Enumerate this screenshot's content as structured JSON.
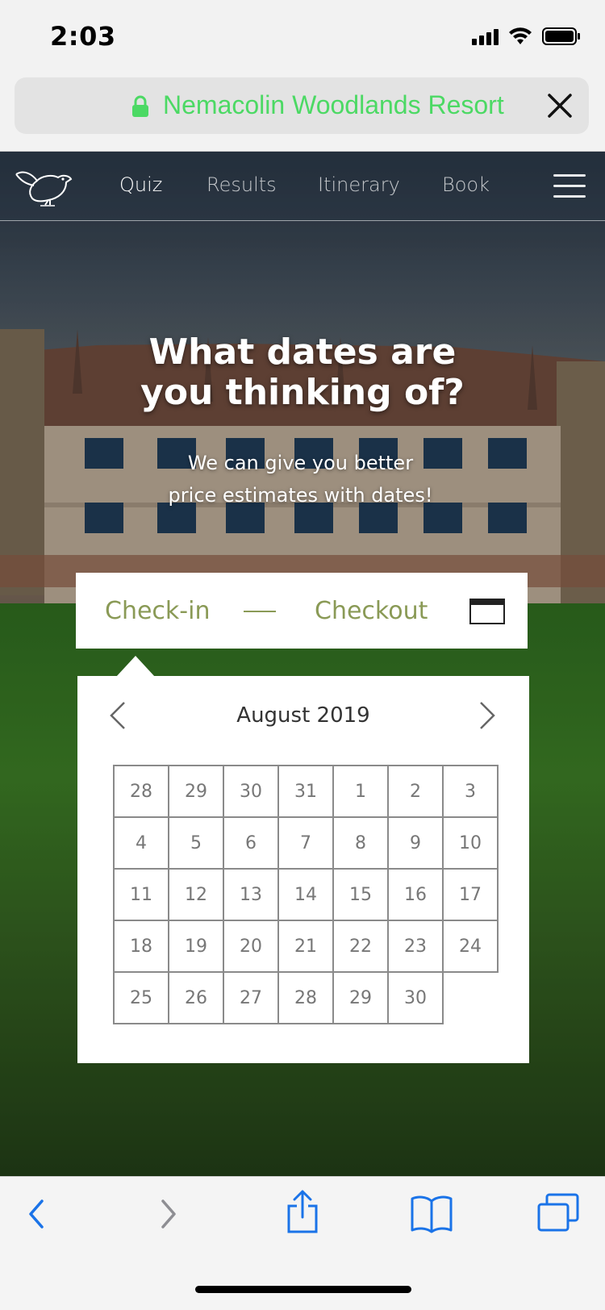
{
  "status_bar": {
    "time": "2:03"
  },
  "browser": {
    "site_name": "Nemacolin Woodlands Resort",
    "lock_color": "#4cd964"
  },
  "nav": {
    "items": [
      {
        "label": "Quiz",
        "active": true
      },
      {
        "label": "Results",
        "active": false
      },
      {
        "label": "Itinerary",
        "active": false
      },
      {
        "label": "Book",
        "active": false
      }
    ]
  },
  "hero": {
    "title_line1": "What dates are",
    "title_line2": "you thinking of?",
    "subtitle_line1": "We can give you better",
    "subtitle_line2": "price estimates with dates!"
  },
  "date_picker": {
    "checkin_label": "Check-in",
    "checkout_label": "Checkout",
    "accent_color": "#8a9a56"
  },
  "calendar": {
    "month_label": "August 2019",
    "weeks": [
      [
        "28",
        "29",
        "30",
        "31",
        "1",
        "2",
        "3"
      ],
      [
        "4",
        "5",
        "6",
        "7",
        "8",
        "9",
        "10"
      ],
      [
        "11",
        "12",
        "13",
        "14",
        "15",
        "16",
        "17"
      ],
      [
        "18",
        "19",
        "20",
        "21",
        "22",
        "23",
        "24"
      ],
      [
        "25",
        "26",
        "27",
        "28",
        "29",
        "30",
        ""
      ]
    ]
  },
  "toolbar": {
    "icons": [
      "back-icon",
      "forward-icon",
      "share-icon",
      "bookmarks-icon",
      "tabs-icon"
    ],
    "accent_color": "#1a73e8"
  }
}
